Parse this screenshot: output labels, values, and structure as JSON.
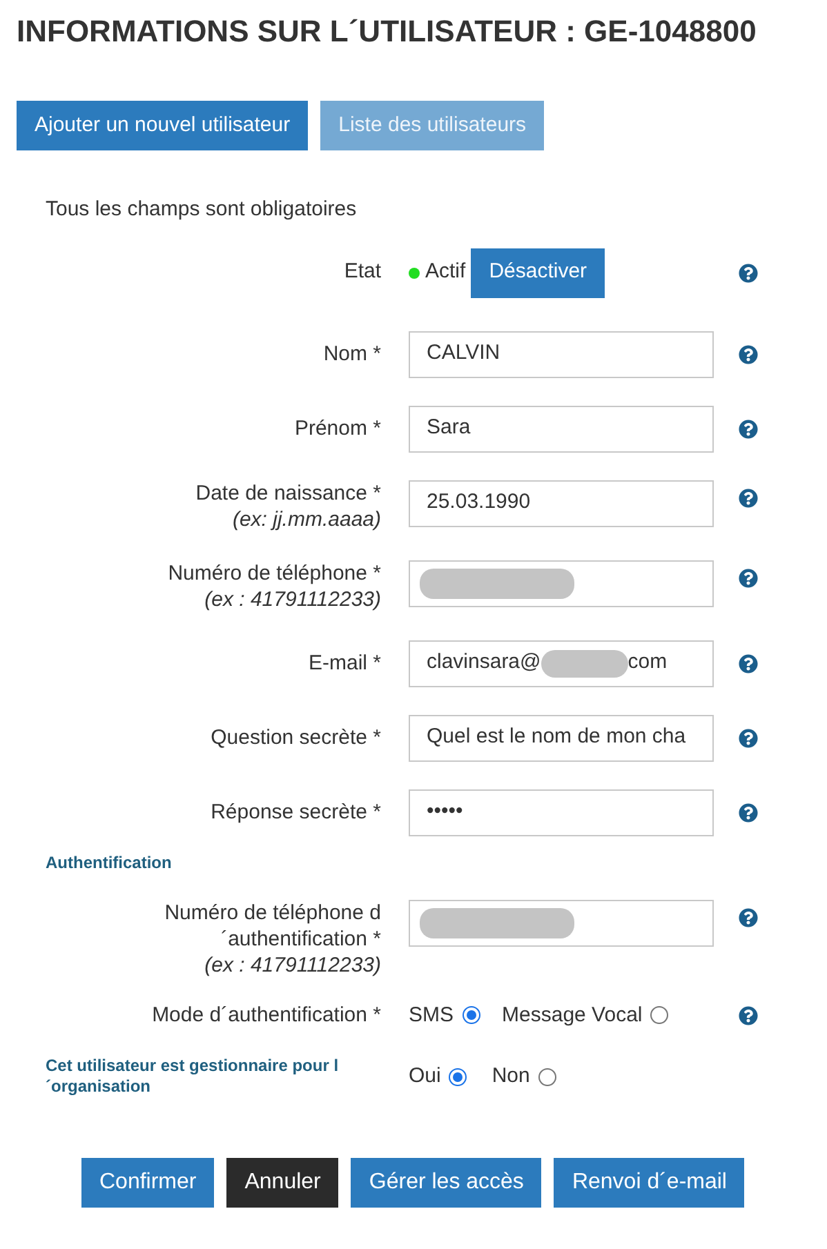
{
  "title": "INFORMATIONS SUR L´UTILISATEUR : GE-1048800",
  "top_buttons": [
    {
      "label": "Ajouter un nouvel utilisateur",
      "disabled": false
    },
    {
      "label": "Liste des utilisateurs",
      "disabled": true
    }
  ],
  "intro": "Tous les champs sont obligatoires",
  "state": {
    "label": "Etat",
    "status": "Actif",
    "active": true,
    "button": "Désactiver"
  },
  "fields": [
    {
      "label": "Nom *",
      "kind": "text",
      "value": "CALVIN"
    },
    {
      "label": "Prénom *",
      "kind": "text",
      "value": "Sara"
    },
    {
      "label": "Date de naissance *",
      "hint": "(ex: jj.mm.aaaa)",
      "kind": "text",
      "value": "25.03.1990"
    },
    {
      "label": "Numéro de téléphone *",
      "hint": "(ex : 41791112233)",
      "kind": "redacted"
    },
    {
      "label": "E-mail *",
      "kind": "partial",
      "value_start": "clavinsara@",
      "value_end": "com"
    },
    {
      "label": "Question secrète *",
      "kind": "text",
      "value": "Quel est le nom de mon cha"
    },
    {
      "label": "Réponse secrète *",
      "kind": "text",
      "value": "•••••"
    }
  ],
  "auth": {
    "title": "Authentification",
    "phone": {
      "label_lines": [
        "Numéro de téléphone d",
        "´authentification *"
      ],
      "hint": "(ex : 41791112233)",
      "kind": "redacted"
    },
    "mode": {
      "label": "Mode d´authentification *",
      "options": [
        {
          "label": "SMS",
          "selected": true
        },
        {
          "label": "Message Vocal",
          "selected": false
        }
      ]
    }
  },
  "manager": {
    "label_lines": [
      "Cet utilisateur est gestionnaire pour l",
      "´organisation"
    ],
    "options": [
      {
        "label": "Oui",
        "selected": true
      },
      {
        "label": "Non",
        "selected": false
      }
    ]
  },
  "bottom_buttons": [
    {
      "label": "Confirmer",
      "kind": "primary"
    },
    {
      "label": "Annuler",
      "kind": "dark"
    },
    {
      "label": "Gérer les accès",
      "kind": "primary"
    },
    {
      "label": "Renvoi d´e-mail",
      "kind": "primary"
    }
  ]
}
